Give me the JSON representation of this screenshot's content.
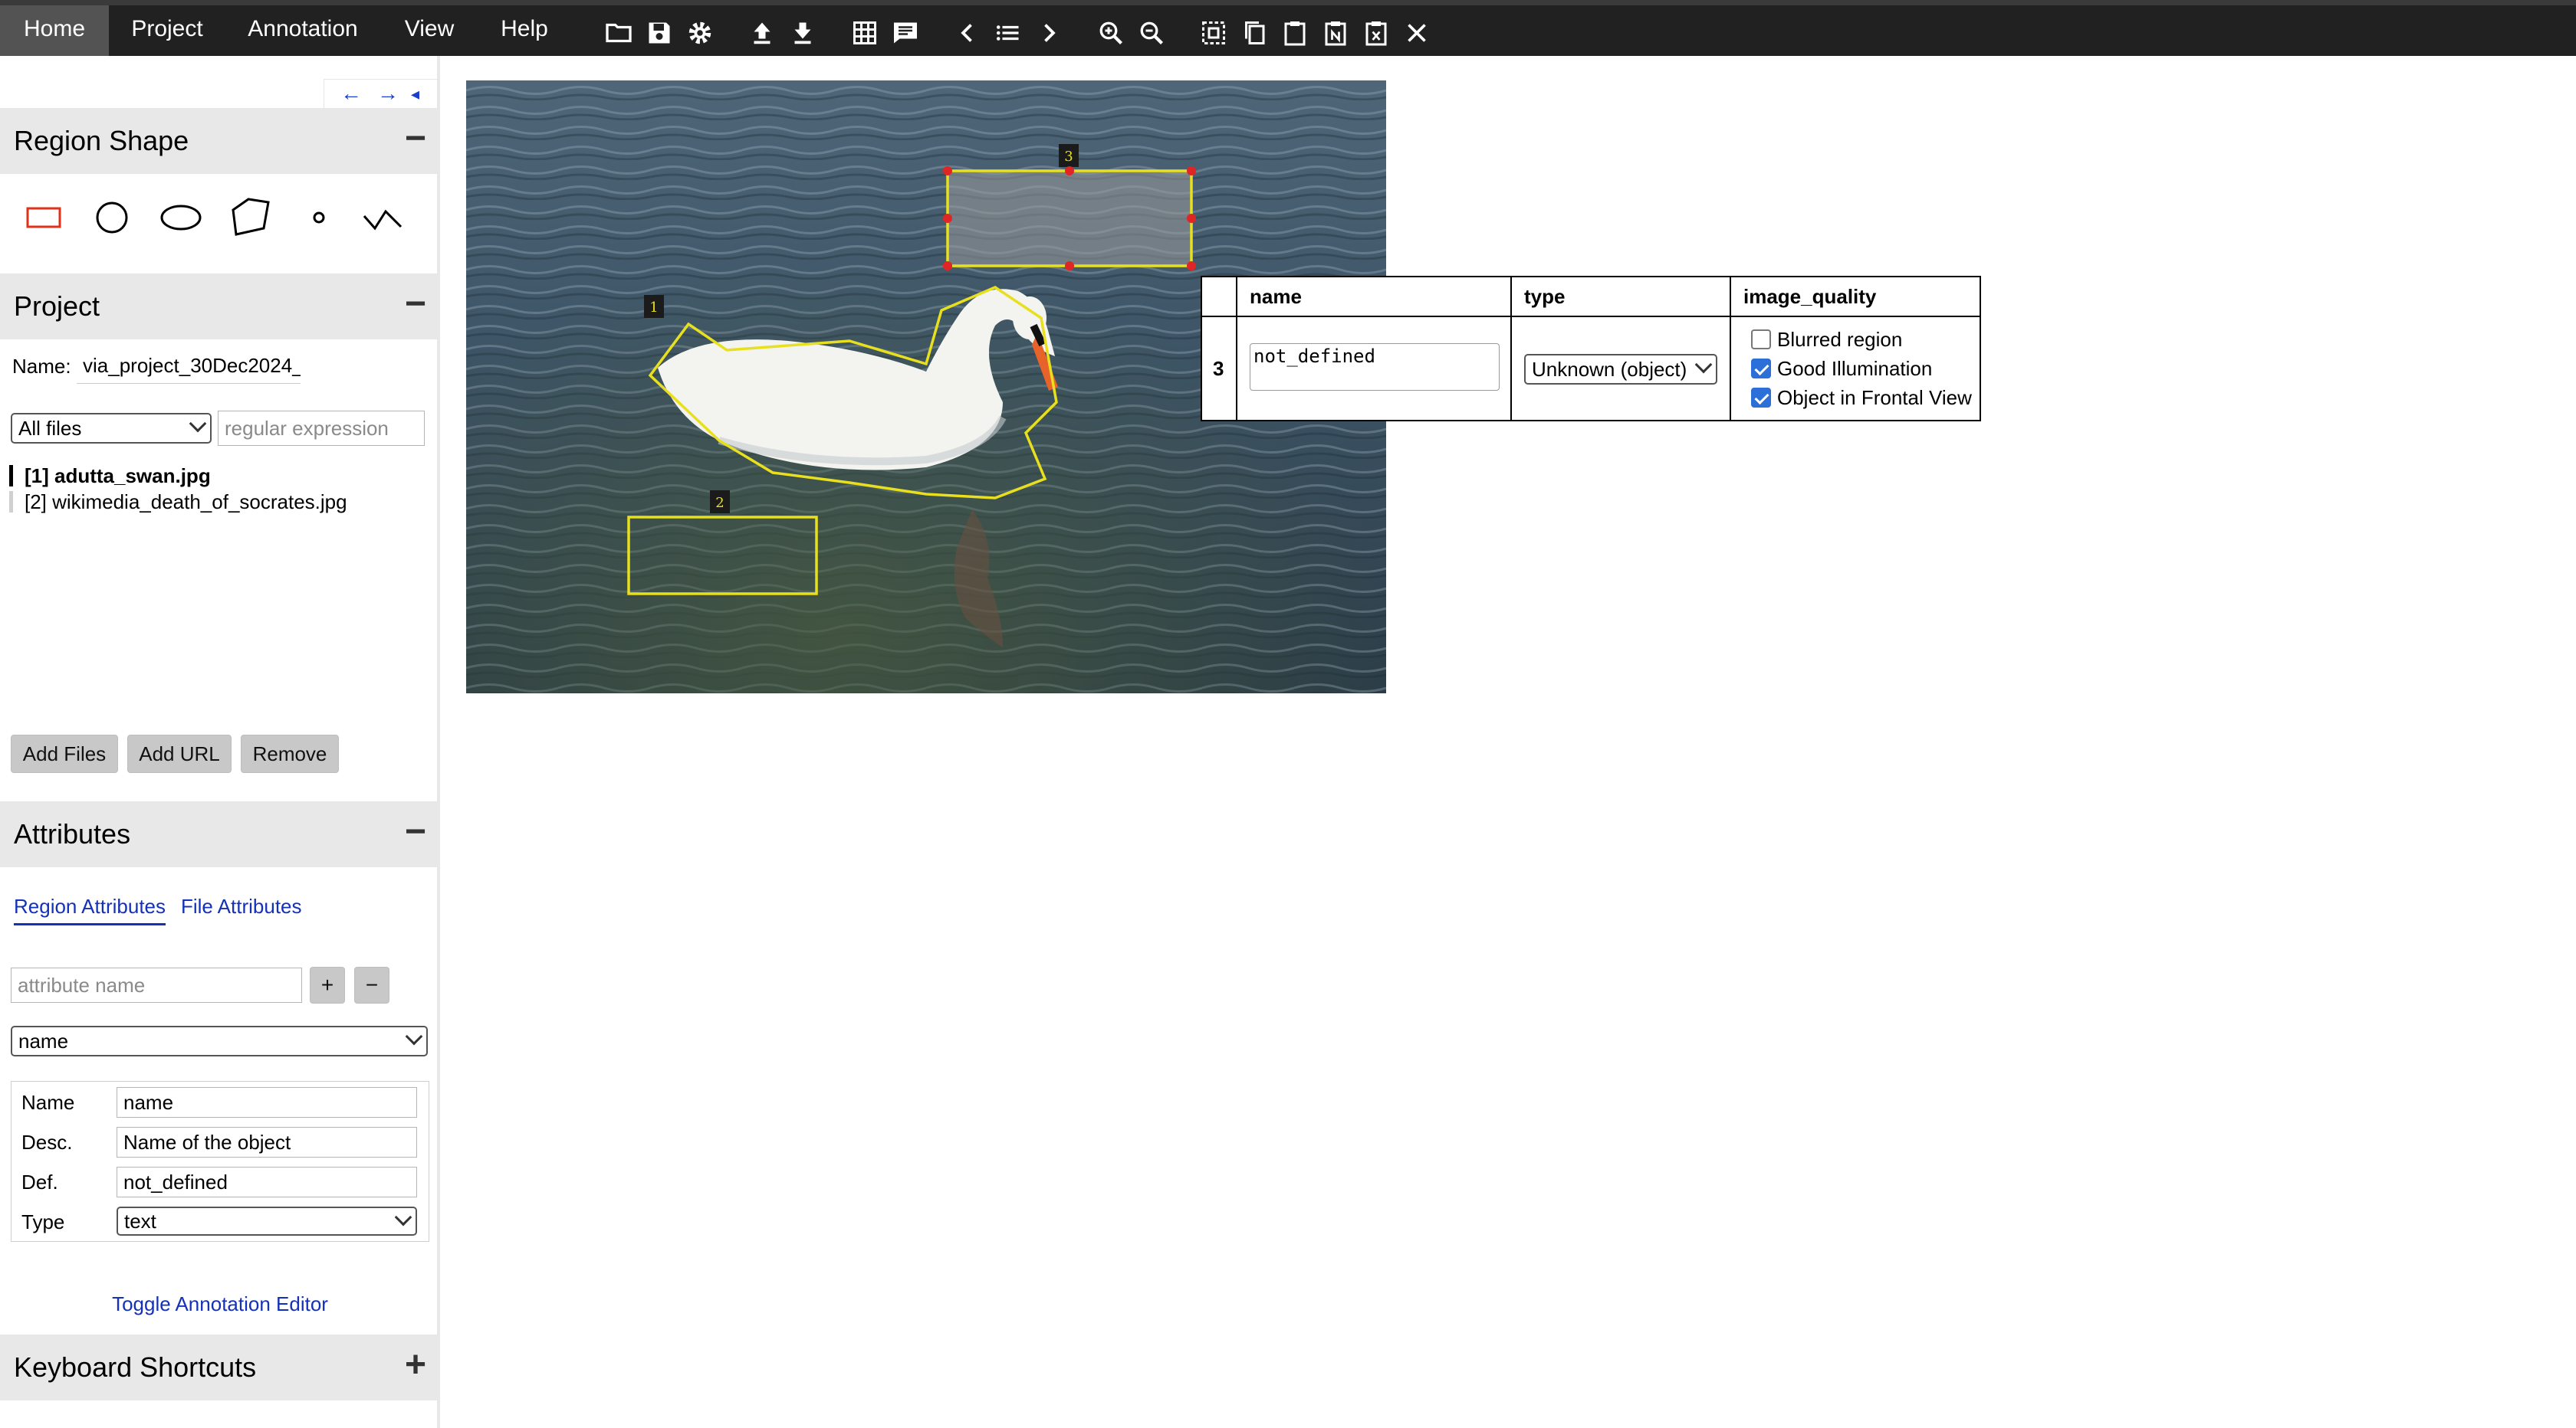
{
  "menu": {
    "items": [
      "Home",
      "Project",
      "Annotation",
      "View",
      "Help"
    ],
    "active": "Home"
  },
  "toolbar": {
    "icons": [
      "folder-open-icon",
      "save-icon",
      "settings-icon",
      "upload-icon",
      "download-icon",
      "grid-view-icon",
      "comment-icon",
      "previous-icon",
      "list-icon",
      "next-icon",
      "zoom-in-icon",
      "zoom-out-icon",
      "select-all-icon",
      "copy-icon",
      "paste-icon",
      "paste-n-icon",
      "delete-regions-icon",
      "close-icon"
    ]
  },
  "left_panel": {
    "nav_arrows": {
      "left": "←",
      "right": "→",
      "collapse": "◂"
    },
    "region_shape": {
      "title": "Region Shape",
      "toggle": "−",
      "shapes": [
        "rectangle",
        "circle",
        "ellipse",
        "polygon",
        "point",
        "polyline"
      ],
      "active_shape": "rectangle"
    },
    "project": {
      "title": "Project",
      "toggle": "−",
      "name_label": "Name:",
      "name_value": "via_project_30Dec2024_",
      "filter_select": "All files",
      "regex_placeholder": "regular expression",
      "files": [
        {
          "label": "[1] adutta_swan.jpg",
          "selected": true
        },
        {
          "label": "[2] wikimedia_death_of_socrates.jpg",
          "selected": false
        }
      ],
      "buttons": {
        "add_files": "Add Files",
        "add_url": "Add URL",
        "remove": "Remove"
      }
    },
    "attributes": {
      "title": "Attributes",
      "toggle": "−",
      "tabs": {
        "region": "Region Attributes",
        "file": "File Attributes"
      },
      "attr_name_placeholder": "attribute name",
      "add_symbol": "+",
      "remove_symbol": "−",
      "selected_attribute": "name",
      "details": {
        "name_label": "Name",
        "name_value": "name",
        "desc_label": "Desc.",
        "desc_value": "Name of the object",
        "def_label": "Def.",
        "def_value": "not_defined",
        "type_label": "Type",
        "type_value": "text"
      },
      "toggle_editor_link": "Toggle Annotation Editor"
    },
    "keyboard": {
      "title": "Keyboard Shortcuts",
      "toggle": "+"
    }
  },
  "canvas": {
    "region_labels": [
      "1",
      "2",
      "3"
    ],
    "region_color": "#e8e01e",
    "vertex_color": "#e02525"
  },
  "annotation_editor": {
    "headers": {
      "name": "name",
      "type": "type",
      "image_quality": "image_quality"
    },
    "row": {
      "region_id": "3",
      "name_value": "not_defined",
      "type_value": "Unknown (object)",
      "quality_options": [
        {
          "label": "Blurred region",
          "checked": false
        },
        {
          "label": "Good Illumination",
          "checked": true
        },
        {
          "label": "Object in Frontal View",
          "checked": true
        }
      ]
    }
  }
}
